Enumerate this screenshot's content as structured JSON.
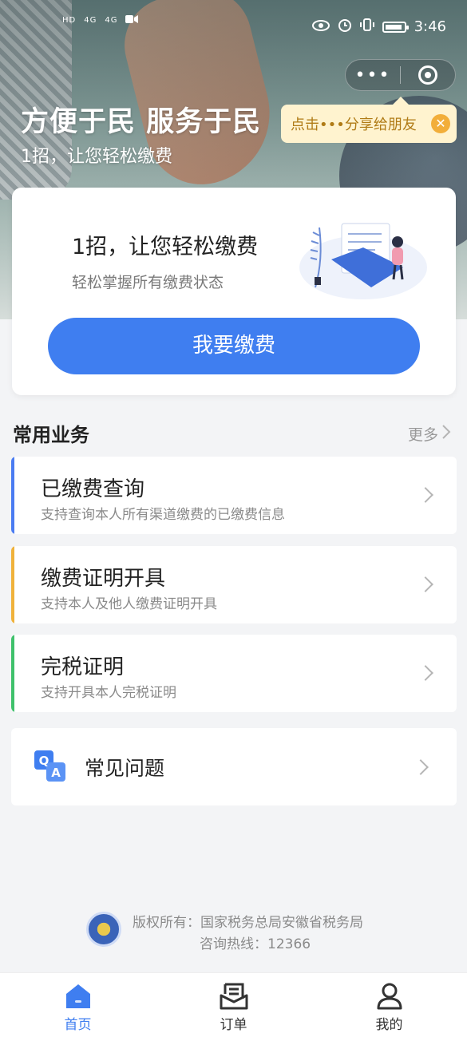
{
  "status_bar": {
    "left_glyphs": [
      "HD",
      "4G",
      "4G"
    ],
    "time": "3:46",
    "battery_level": 0.9
  },
  "capsule": {
    "more": "•••"
  },
  "share_tip": {
    "text": "点击•••分享给朋友",
    "close": "✕"
  },
  "hero": {
    "title": "方便于民 服务于民",
    "subtitle": "1招，让您轻松缴费"
  },
  "main_card": {
    "title": "1招，让您轻松缴费",
    "desc": "轻松掌握所有缴费状态",
    "pay_button": "我要缴费"
  },
  "section": {
    "title": "常用业务",
    "more": "更多"
  },
  "services": [
    {
      "name": "已缴费查询",
      "info": "支持查询本人所有渠道缴费的已缴费信息",
      "accent": "#4a7cf2"
    },
    {
      "name": "缴费证明开具",
      "info": "支持本人及他人缴费证明开具",
      "accent": "#f0b23b"
    },
    {
      "name": "完税证明",
      "info": "支持开具本人完税证明",
      "accent": "#3fc16b"
    }
  ],
  "faq": {
    "label": "常见问题",
    "icon_q": "Q",
    "icon_a": "A"
  },
  "footer": {
    "copyright": "版权所有：国家税务总局安徽省税务局",
    "hotline": "咨询热线：12366"
  },
  "tabbar": [
    {
      "label": "首页",
      "icon": "home-icon",
      "active": true
    },
    {
      "label": "订单",
      "icon": "order-icon",
      "active": false
    },
    {
      "label": "我的",
      "icon": "profile-icon",
      "active": false
    }
  ],
  "colors": {
    "primary": "#3f7ef0"
  }
}
